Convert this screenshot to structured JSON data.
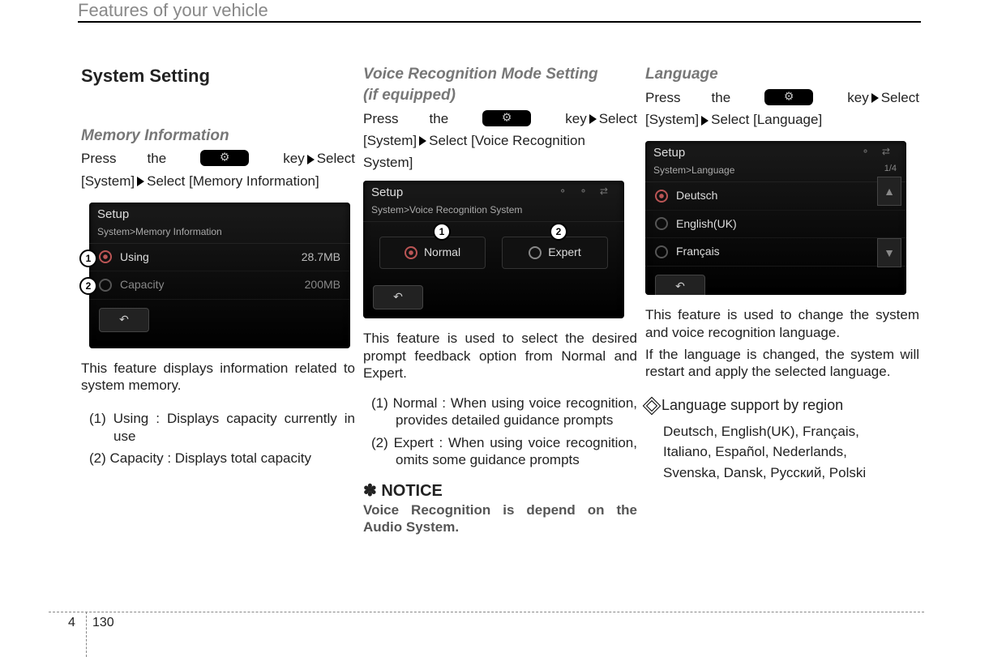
{
  "header": {
    "title": "Features of your vehicle"
  },
  "footer": {
    "chapter": "4",
    "page": "130"
  },
  "col1": {
    "section_title": "System Setting",
    "subhead": "Memory Information",
    "press_line_a": "Press",
    "press_line_the": "the",
    "press_line_key": "key",
    "press_line_select": "Select",
    "press_line2": "[System]   Select [Memory Information]",
    "screenshot": {
      "title": "Setup",
      "breadcrumb": "System>Memory Information",
      "row1_label": "Using",
      "row1_val": "28.7MB",
      "row2_label": "Capacity",
      "row2_val": "200MB",
      "marker1": "1",
      "marker2": "2"
    },
    "body1": "This feature displays information related to system memory.",
    "li1": "(1) Using : Displays capacity currently in use",
    "li2": "(2) Capacity : Displays total capacity"
  },
  "col2": {
    "subhead_l1": "Voice Recognition Mode Setting",
    "subhead_l2": "(if equipped)",
    "press_line_a": "Press",
    "press_line_the": "the",
    "press_line_key": "key",
    "press_line_select": "Select",
    "press_line2a": "[System]   Select [Voice Recognition",
    "press_line2b": "System]",
    "screenshot": {
      "title": "Setup",
      "breadcrumb": "System>Voice Recognition System",
      "opt1": "Normal",
      "opt2": "Expert",
      "marker1": "1",
      "marker2": "2"
    },
    "body1": "This feature is used to select the desired prompt feedback option from Normal and Expert.",
    "li1": "(1) Normal : When using voice recognition, provides detailed guidance prompts",
    "li2": "(2) Expert : When using voice recognition, omits some guidance prompts",
    "notice_label": "✽ NOTICE",
    "notice_body": "Voice Recognition is depend on the Audio System."
  },
  "col3": {
    "subhead": "Language",
    "press_line_a": "Press",
    "press_line_the": "the",
    "press_line_key": "key",
    "press_line_select": "Select",
    "press_line2": "[System]   Select [Language]",
    "screenshot": {
      "title": "Setup",
      "breadcrumb": "System>Language",
      "pagecount": "1/4",
      "row1": "Deutsch",
      "row2": "English(UK)",
      "row3": "Français"
    },
    "body1": "This feature is used to change the system and voice recognition language.",
    "body2": "If the language is changed, the system will restart and apply the selected language.",
    "support_label": "Language support by region",
    "support_list1": "Deutsch, English(UK), Français,",
    "support_list2": "Italiano, Español, Nederlands,",
    "support_list3": "Svenska, Dansk, Русский, Polski"
  }
}
